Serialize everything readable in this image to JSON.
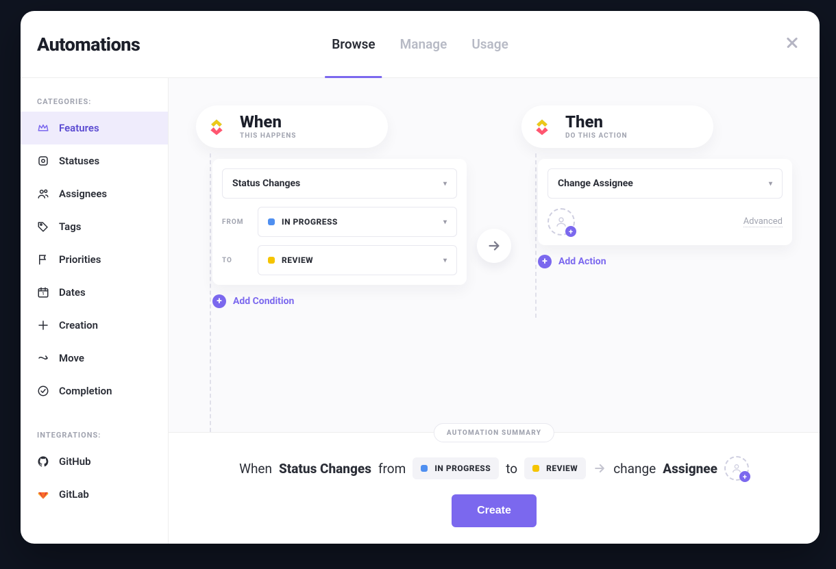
{
  "header": {
    "title": "Automations",
    "tabs": {
      "browse": "Browse",
      "manage": "Manage",
      "usage": "Usage"
    },
    "active_tab": "browse"
  },
  "sidebar": {
    "categories_label": "CATEGORIES:",
    "items": {
      "features": "Features",
      "statuses": "Statuses",
      "assignees": "Assignees",
      "tags": "Tags",
      "priorities": "Priorities",
      "dates": "Dates",
      "creation": "Creation",
      "move": "Move",
      "completion": "Completion"
    },
    "integrations_label": "INTEGRATIONS:",
    "integrations": {
      "github": "GitHub",
      "gitlab": "GitLab"
    }
  },
  "when": {
    "title": "When",
    "subtitle": "THIS HAPPENS",
    "trigger": "Status Changes",
    "from_label": "FROM",
    "from_status": "IN PROGRESS",
    "from_color": "#4f8ff0",
    "to_label": "TO",
    "to_status": "REVIEW",
    "to_color": "#f5c400",
    "add_condition": "Add Condition"
  },
  "then": {
    "title": "Then",
    "subtitle": "DO THIS ACTION",
    "action": "Change Assignee",
    "advanced": "Advanced",
    "add_action": "Add Action"
  },
  "summary": {
    "badge": "AUTOMATION SUMMARY",
    "when_text": "When",
    "trigger": "Status Changes",
    "from_text": "from",
    "to_text": "to",
    "change_text": "change",
    "assignee_text": "Assignee",
    "create_btn": "Create"
  }
}
